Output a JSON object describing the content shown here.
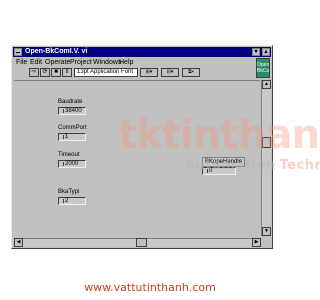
{
  "window": {
    "title": "Open-BkComI.V. vi",
    "minimize_icon": "minimize-icon",
    "maximize_icon": "maximize-icon"
  },
  "menu": [
    "File",
    "Edit",
    "Operate",
    "Project",
    "Windows",
    "Help"
  ],
  "toolbar": {
    "font_selector": "13pt Application Font",
    "run_badge": "Open BkCo"
  },
  "controls": [
    {
      "label": "Baudrate",
      "value": "38400"
    },
    {
      "label": "CommPort",
      "value": "1"
    },
    {
      "label": "Timeout",
      "value": "2000"
    },
    {
      "label": "BkaTypi",
      "value": "2"
    }
  ],
  "indicator": {
    "label": "BKopeHandle",
    "value": "0"
  },
  "watermark": {
    "logo": "tktinthanh",
    "tag_1": "Automation",
    "tag_2": "Technology",
    "url": "www.vattutinthanh.com"
  }
}
